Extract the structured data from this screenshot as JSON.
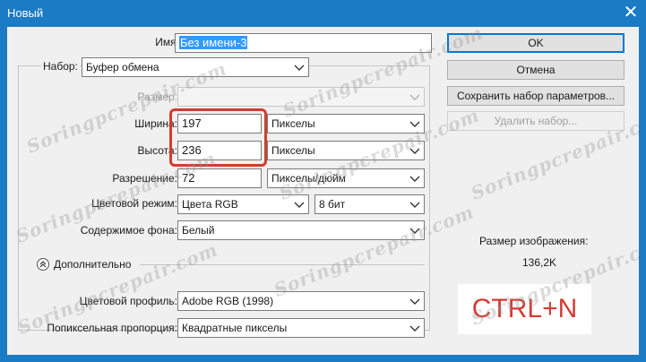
{
  "window": {
    "title": "Новый",
    "close_glyph": "✕"
  },
  "name": {
    "label": "Имя:",
    "value": "Без имени-3"
  },
  "preset": {
    "label": "Набор:",
    "value": "Буфер обмена"
  },
  "size": {
    "label": "Размер:",
    "value": ""
  },
  "width": {
    "label": "Ширина:",
    "value": "197",
    "unit": "Пикселы"
  },
  "height": {
    "label": "Высота:",
    "value": "236",
    "unit": "Пикселы"
  },
  "resolution": {
    "label": "Разрешение:",
    "value": "72",
    "unit": "Пикселы/дюйм"
  },
  "color_mode": {
    "label": "Цветовой режим:",
    "value": "Цвета RGB",
    "depth": "8 бит"
  },
  "background": {
    "label": "Содержимое фона:",
    "value": "Белый"
  },
  "advanced": {
    "label": "Дополнительно"
  },
  "color_profile": {
    "label": "Цветовой профиль:",
    "value": "Adobe RGB (1998)"
  },
  "pixel_aspect": {
    "label": "Попиксельная пропорция:",
    "value": "Квадратные пикселы"
  },
  "buttons": {
    "ok": "OK",
    "cancel": "Отмена",
    "save_preset": "Сохранить набор параметров...",
    "delete_preset": "Удалить набор..."
  },
  "image_size": {
    "label": "Размер изображения:",
    "value": "136,2K"
  },
  "shortcut_badge": "CTRL+N",
  "watermark": "Soringpcrepair.com",
  "colors": {
    "titlebar": "#1b7bc4",
    "highlight": "#d43b32",
    "selection": "#3399ff"
  }
}
